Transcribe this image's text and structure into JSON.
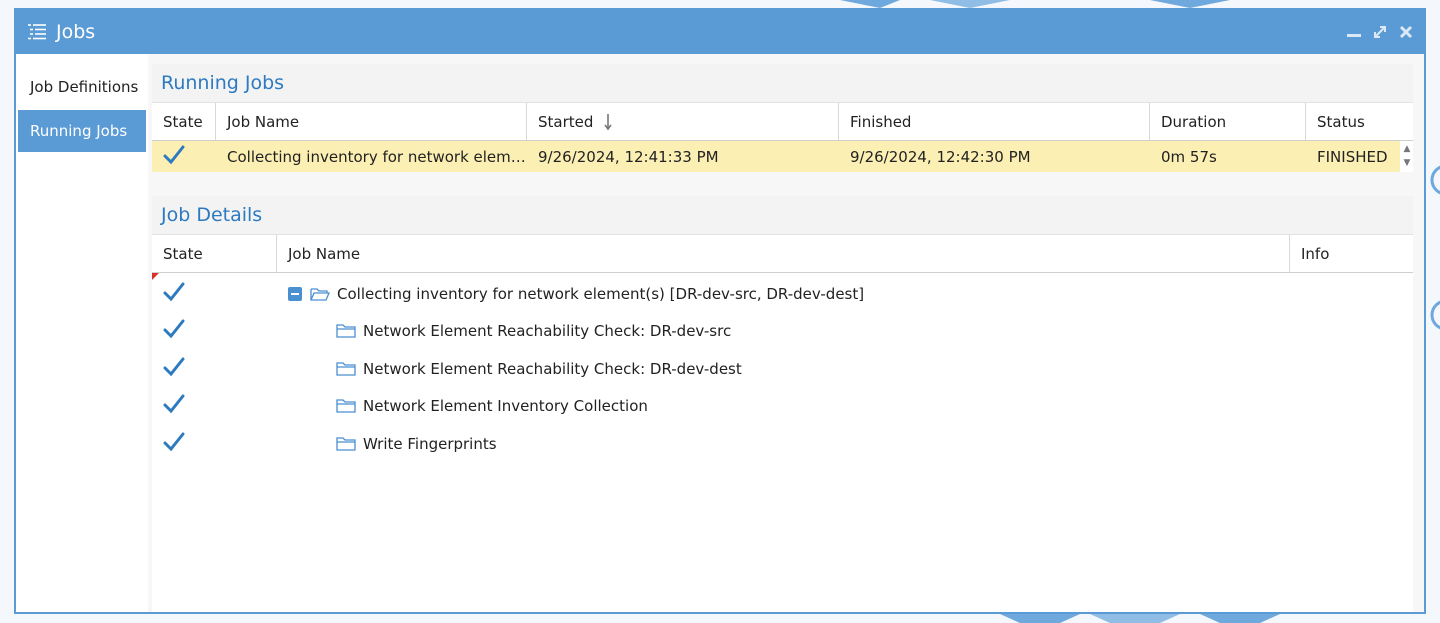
{
  "window": {
    "title": "Jobs",
    "icon": "list-icon"
  },
  "sidebar": {
    "items": [
      {
        "label": "Job Definitions",
        "active": false
      },
      {
        "label": "Running Jobs",
        "active": true
      }
    ]
  },
  "running_jobs": {
    "title": "Running Jobs",
    "columns": [
      "State",
      "Job Name",
      "Started",
      "Finished",
      "Duration",
      "Status"
    ],
    "sorted_column": "Started",
    "rows": [
      {
        "state": "check-icon",
        "job_name": "Collecting inventory for network element(s) [DR-dev-src, DR-dev-dest]",
        "started": "9/26/2024, 12:41:33 PM",
        "finished": "9/26/2024, 12:42:30 PM",
        "duration": "0m 57s",
        "status": "FINISHED"
      }
    ]
  },
  "job_details": {
    "title": "Job Details",
    "columns": [
      "State",
      "Job Name",
      "Info"
    ],
    "root": {
      "state": "check-icon",
      "label": "Collecting inventory for network element(s) [DR-dev-src, DR-dev-dest]"
    },
    "children": [
      {
        "state": "check-icon",
        "label": "Network Element Reachability Check: DR-dev-src"
      },
      {
        "state": "check-icon",
        "label": "Network Element Reachability Check: DR-dev-dest"
      },
      {
        "state": "check-icon",
        "label": "Network Element Inventory Collection"
      },
      {
        "state": "check-icon",
        "label": "Write Fingerprints"
      }
    ]
  },
  "colors": {
    "accent": "#5b9bd5",
    "title_text": "#2d7ac0",
    "selected_row": "#fcefb4",
    "check": "#2d7ac0"
  }
}
